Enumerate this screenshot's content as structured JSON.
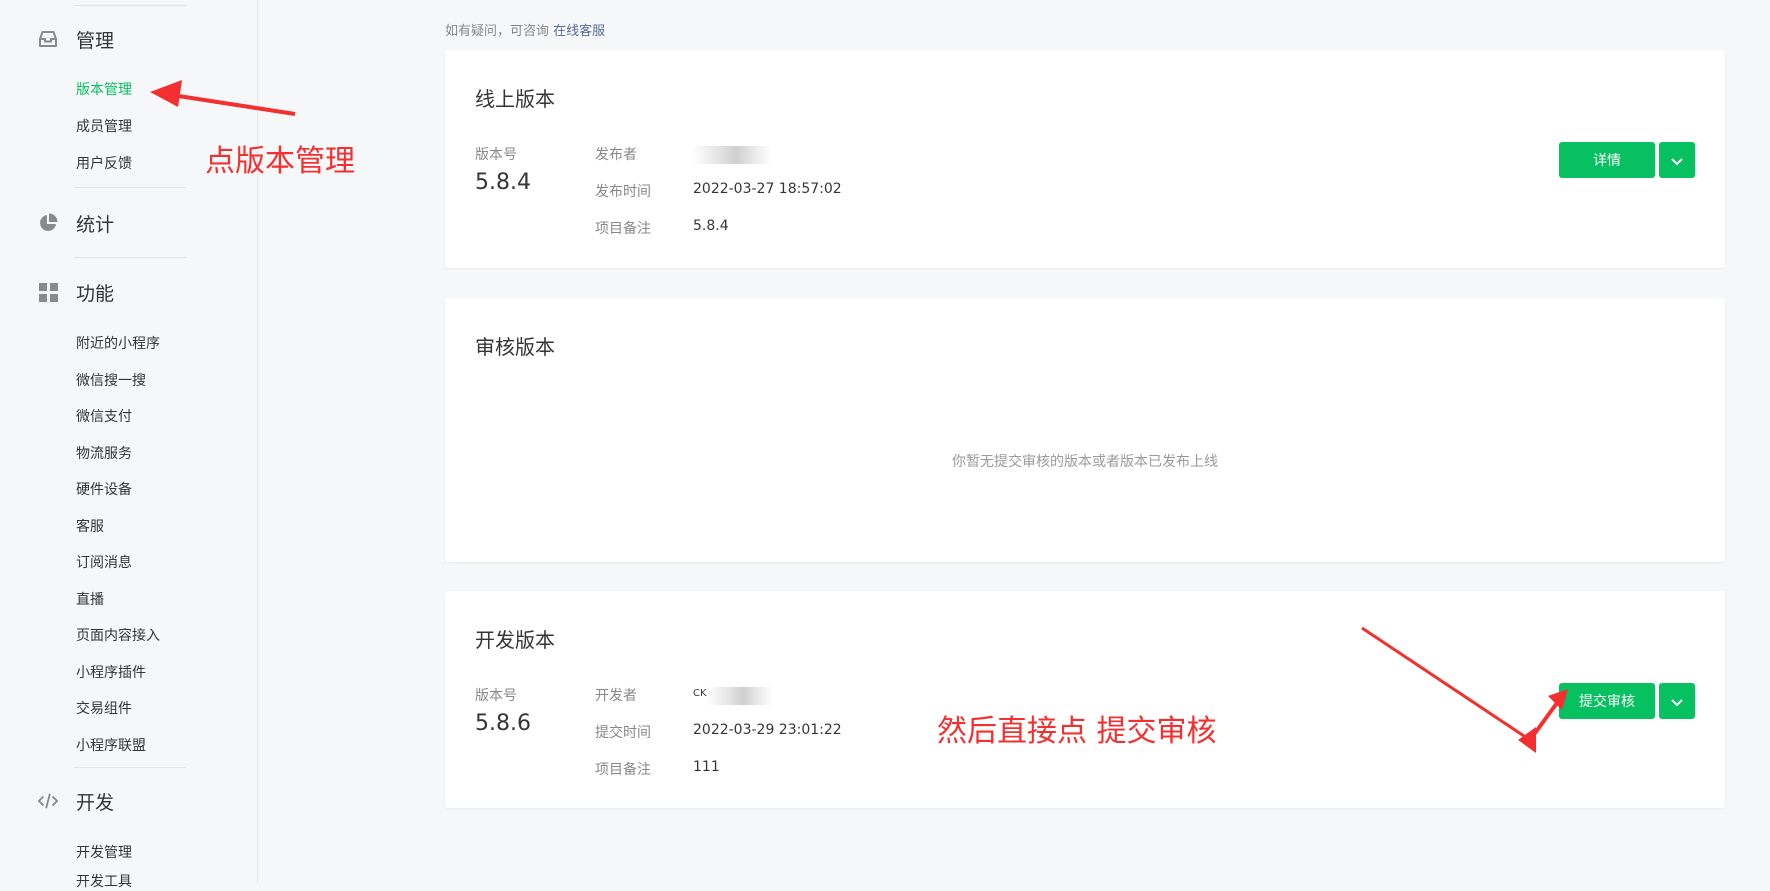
{
  "sidebar": {
    "manage": {
      "title": "管理",
      "icon": "inbox-icon",
      "items": [
        "版本管理",
        "成员管理",
        "用户反馈"
      ]
    },
    "stats": {
      "title": "统计",
      "icon": "pie-chart-icon"
    },
    "features": {
      "title": "功能",
      "icon": "grid-icon",
      "items": [
        "附近的小程序",
        "微信搜一搜",
        "微信支付",
        "物流服务",
        "硬件设备",
        "客服",
        "订阅消息",
        "直播",
        "页面内容接入",
        "小程序插件",
        "交易组件",
        "小程序联盟"
      ]
    },
    "dev": {
      "title": "开发",
      "icon": "code-icon",
      "items": [
        "开发管理",
        "开发工具"
      ]
    }
  },
  "main": {
    "note_prefix": "如有疑问，可咨询",
    "note_link": "在线客服",
    "online": {
      "title": "线上版本",
      "version_label": "版本号",
      "version": "5.8.4",
      "publisher_label": "发布者",
      "time_label": "发布时间",
      "time": "2022-03-27 18:57:02",
      "remark_label": "项目备注",
      "remark": "5.8.4",
      "button": "详情"
    },
    "review": {
      "title": "审核版本",
      "empty": "你暂无提交审核的版本或者版本已发布上线"
    },
    "dev_version": {
      "title": "开发版本",
      "version_label": "版本号",
      "version": "5.8.6",
      "developer_label": "开发者",
      "developer_partial": "CK",
      "time_label": "提交时间",
      "time": "2022-03-29 23:01:22",
      "remark_label": "项目备注",
      "remark": "111",
      "button": "提交审核"
    }
  },
  "annotations": {
    "first": "点版本管理",
    "second": "然后直接点  提交审核"
  },
  "colors": {
    "accent": "#07c160",
    "annotation": "#f3302f",
    "link": "#576b95"
  }
}
